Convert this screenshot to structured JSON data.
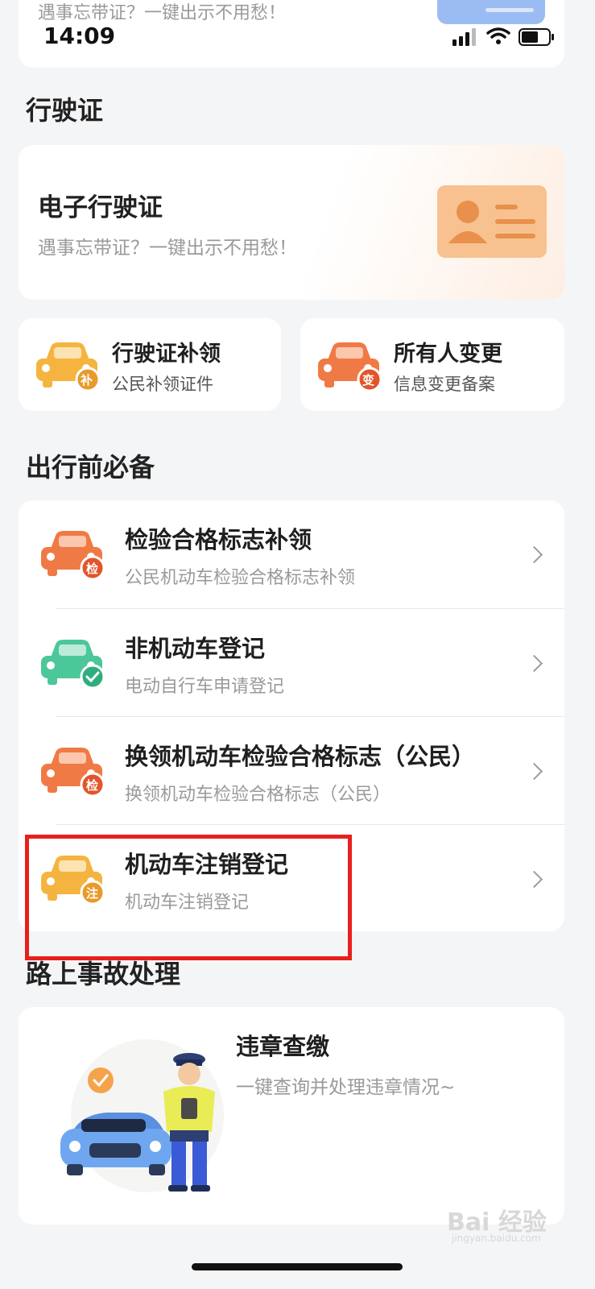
{
  "status_bar": {
    "time": "14:09"
  },
  "top_card": {
    "subtitle": "遇事忘带证？一键出示不用愁！"
  },
  "section_license": {
    "title": "行驶证",
    "card": {
      "title": "电子行驶证",
      "subtitle": "遇事忘带证？一键出示不用愁！"
    },
    "quick": [
      {
        "title": "行驶证补领",
        "subtitle": "公民补领证件",
        "badge": "补"
      },
      {
        "title": "所有人变更",
        "subtitle": "信息变更备案",
        "badge": "变"
      }
    ]
  },
  "section_pretrip": {
    "title": "出行前必备",
    "items": [
      {
        "title": "检验合格标志补领",
        "subtitle": "公民机动车检验合格标志补领",
        "badge": "检"
      },
      {
        "title": "非机动车登记",
        "subtitle": "电动自行车申请登记",
        "badge": ""
      },
      {
        "title": "换领机动车检验合格标志（公民）",
        "subtitle": "换领机动车检验合格标志（公民）",
        "badge": "检"
      },
      {
        "title": "机动车注销登记",
        "subtitle": "机动车注销登记",
        "badge": "注"
      }
    ]
  },
  "section_accident": {
    "title": "路上事故处理",
    "card": {
      "title": "违章查缴",
      "subtitle": "一键查询并处理违章情况~"
    }
  },
  "watermark": {
    "text": "Bai 经验",
    "sub": "jingyan.baidu.com"
  },
  "colors": {
    "orange": "#f07a45",
    "yellow": "#f5b43f",
    "green": "#4cc79a",
    "highlight": "#e8201d"
  }
}
